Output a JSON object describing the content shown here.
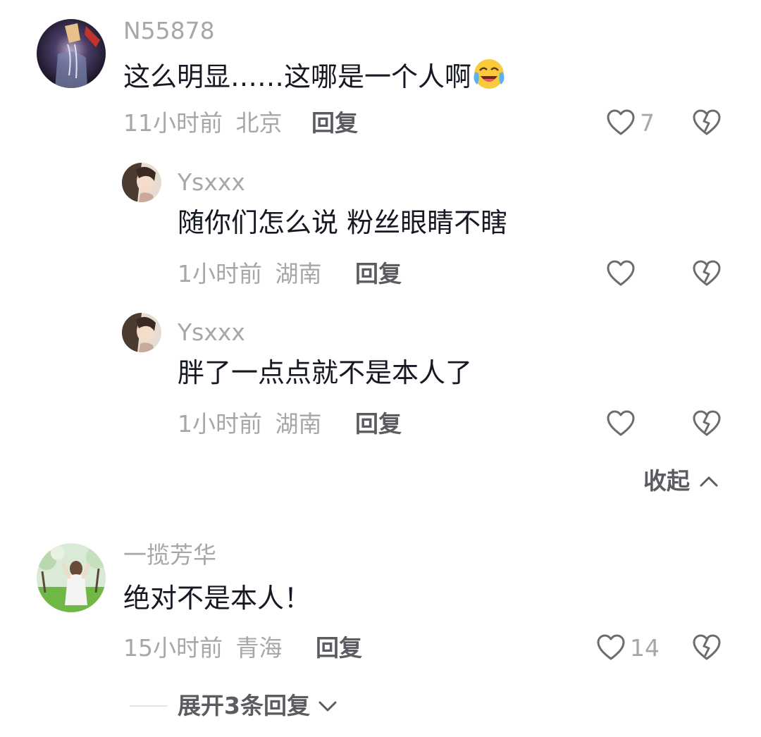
{
  "comments": [
    {
      "username": "N55878",
      "text": "这么明显……这哪是一个人啊",
      "emoji": "cry-laughing-emoji",
      "time": "11小时前",
      "location": "北京",
      "reply_label": "回复",
      "likes": "7"
    },
    {
      "username": "一揽芳华",
      "text": "绝对不是本人！",
      "time": "15小时前",
      "location": "青海",
      "reply_label": "回复",
      "likes": "14",
      "expand_label": "展开3条回复"
    }
  ],
  "replies": [
    {
      "username": "Ysxxx",
      "text": "随你们怎么说 粉丝眼睛不瞎",
      "time": "1小时前",
      "location": "湖南",
      "reply_label": "回复"
    },
    {
      "username": "Ysxxx",
      "text": "胖了一点点就不是本人了",
      "time": "1小时前",
      "location": "湖南",
      "reply_label": "回复"
    }
  ],
  "collapse_label": "收起",
  "icons": {
    "like": "heart-outline-icon",
    "dislike": "broken-heart-icon",
    "collapse": "chevron-up-icon",
    "expand": "chevron-down-icon"
  },
  "colors": {
    "text_primary": "#161823",
    "text_secondary": "#a6a7ab",
    "text_action": "#5b5c61",
    "icon": "#6b6c70"
  }
}
